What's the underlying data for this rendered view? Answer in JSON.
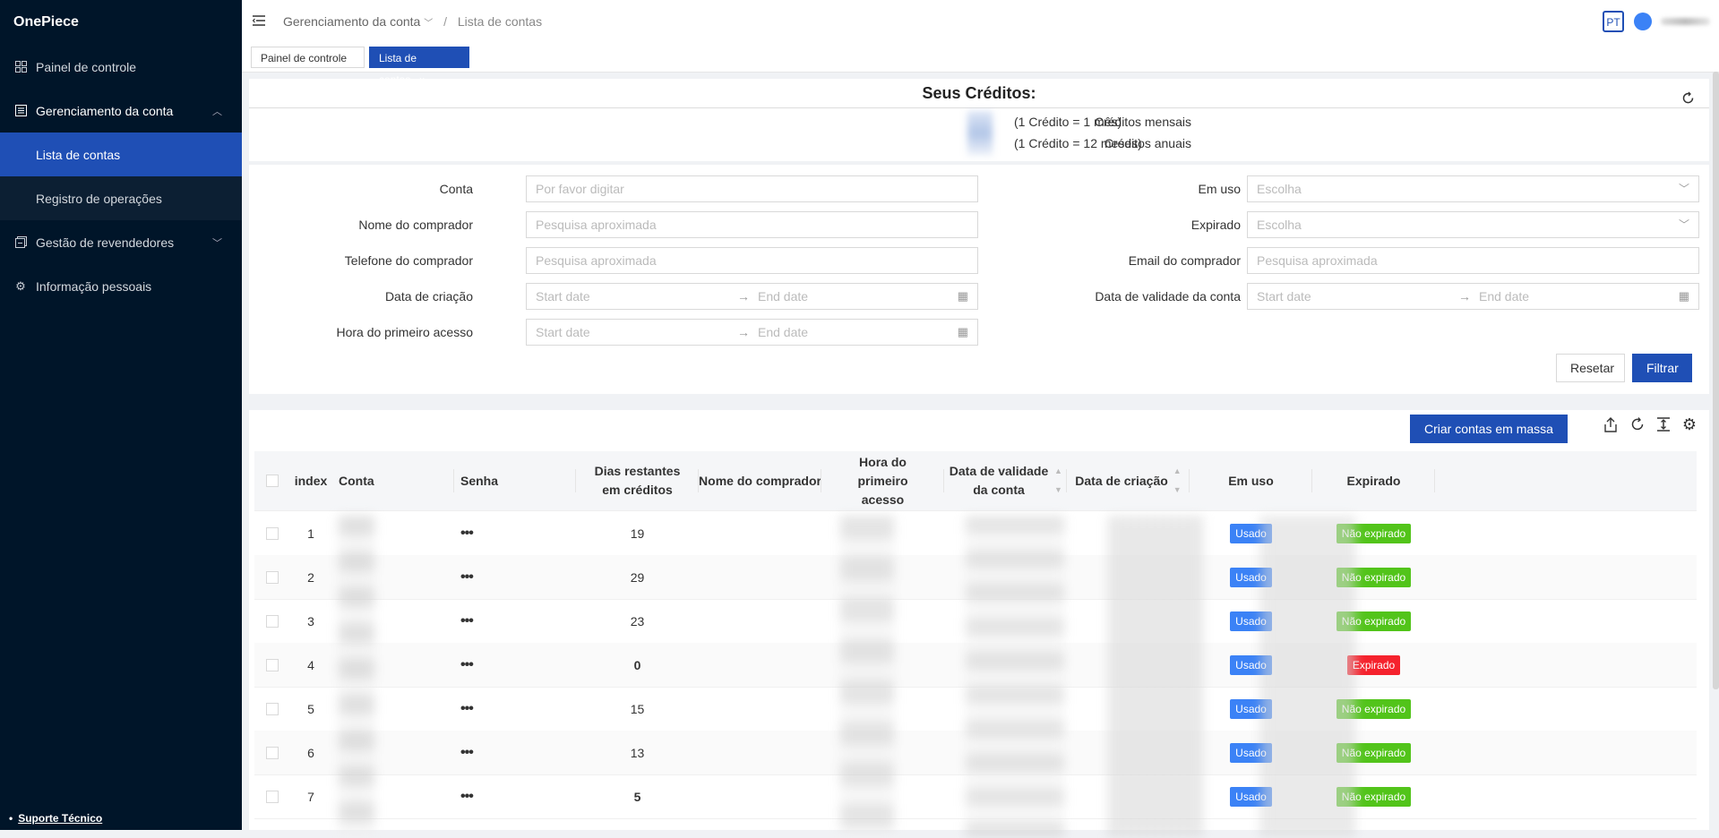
{
  "app": {
    "name": "OnePiece"
  },
  "sidebar": {
    "items": [
      {
        "label": "Painel de controle",
        "icon": "dashboard-icon"
      },
      {
        "label": "Gerenciamento da conta",
        "icon": "account-icon"
      },
      {
        "label": "Lista de contas"
      },
      {
        "label": "Registro de operações"
      },
      {
        "label": "Gestão de revendedores",
        "icon": "reseller-icon"
      },
      {
        "label": "Informação pessoais",
        "icon": "gear-icon"
      }
    ],
    "support": "Suporte Técnico"
  },
  "header": {
    "breadcrumb_1": "Gerenciamento da conta",
    "breadcrumb_sep": "/",
    "breadcrumb_2": "Lista de contas",
    "lang": "PT"
  },
  "tabs": [
    {
      "label": "Painel de controle"
    },
    {
      "label": "Lista de contas",
      "close": "x"
    }
  ],
  "credits": {
    "title": "Seus Créditos:",
    "monthly_label": "Créditos mensais",
    "monthly_note": "(1 Crédito = 1 mês)",
    "annual_label": "Créditos anuais",
    "annual_note": "(1 Crédito = 12 meses)"
  },
  "filters": {
    "conta": {
      "label": "Conta",
      "placeholder": "Por favor digitar"
    },
    "nome": {
      "label": "Nome do comprador",
      "placeholder": "Pesquisa aproximada"
    },
    "telefone": {
      "label": "Telefone do comprador",
      "placeholder": "Pesquisa aproximada"
    },
    "data_criacao": {
      "label": "Data de criação",
      "start": "Start date",
      "end": "End date"
    },
    "hora_acesso": {
      "label": "Hora do primeiro acesso",
      "start": "Start date",
      "end": "End date"
    },
    "em_uso": {
      "label": "Em uso",
      "placeholder": "Escolha"
    },
    "expirado": {
      "label": "Expirado",
      "placeholder": "Escolha"
    },
    "email": {
      "label": "Email do comprador",
      "placeholder": "Pesquisa aproximada"
    },
    "validade": {
      "label": "Data de validade da conta",
      "start": "Start date",
      "end": "End date"
    },
    "reset": "Resetar",
    "submit": "Filtrar"
  },
  "table": {
    "bulk_button": "Criar contas em massa",
    "columns": [
      "index",
      "Conta",
      "Senha",
      "Dias restantes em créditos",
      "Nome do comprador",
      "Hora do primeiro acesso",
      "Data de validade da conta",
      "Data de criação",
      "Em uso",
      "Expirado"
    ],
    "rows": [
      {
        "index": "1",
        "senha": "•••",
        "dias": "19",
        "em_uso": "Usado",
        "expirado": "Não expirado",
        "status": "green"
      },
      {
        "index": "2",
        "senha": "•••",
        "dias": "29",
        "em_uso": "Usado",
        "expirado": "Não expirado",
        "status": "green"
      },
      {
        "index": "3",
        "senha": "•••",
        "dias": "23",
        "em_uso": "Usado",
        "expirado": "Não expirado",
        "status": "green"
      },
      {
        "index": "4",
        "senha": "•••",
        "dias": "0",
        "em_uso": "Usado",
        "expirado": "Expirado",
        "status": "red"
      },
      {
        "index": "5",
        "senha": "•••",
        "dias": "15",
        "em_uso": "Usado",
        "expirado": "Não expirado",
        "status": "green"
      },
      {
        "index": "6",
        "senha": "•••",
        "dias": "13",
        "em_uso": "Usado",
        "expirado": "Não expirado",
        "status": "green"
      },
      {
        "index": "7",
        "senha": "•••",
        "dias": "5",
        "em_uso": "Usado",
        "expirado": "Não expirado",
        "status": "green"
      }
    ]
  },
  "colors": {
    "primary": "#1f4fb5",
    "sidebar": "#001529",
    "green": "#52c41a",
    "red": "#f5222d",
    "blue": "#3b82f6"
  }
}
